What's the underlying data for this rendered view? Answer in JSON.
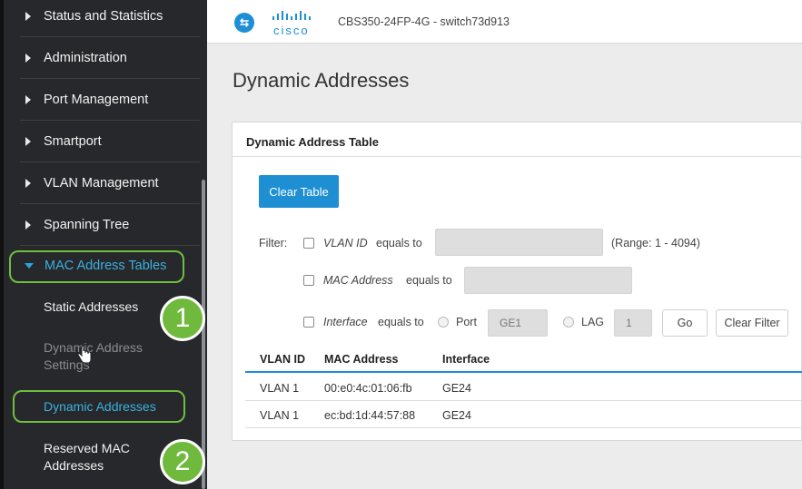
{
  "sidebar": {
    "items": [
      {
        "label": "Status and Statistics"
      },
      {
        "label": "Administration"
      },
      {
        "label": "Port Management"
      },
      {
        "label": "Smartport"
      },
      {
        "label": "VLAN Management"
      },
      {
        "label": "Spanning Tree"
      },
      {
        "label": "MAC Address Tables"
      }
    ],
    "sub_items": [
      {
        "label": "Static Addresses"
      },
      {
        "label": "Dynamic Address"
      },
      {
        "label": "Settings"
      },
      {
        "label": "Dynamic Addresses"
      },
      {
        "label": "Reserved MAC"
      },
      {
        "label": "Addresses"
      }
    ]
  },
  "badges": {
    "one": "1",
    "two": "2"
  },
  "header": {
    "logo_text": "cisco",
    "device": "CBS350-24FP-4G - switch73d913"
  },
  "page": {
    "title": "Dynamic Addresses"
  },
  "panel": {
    "title": "Dynamic Address Table",
    "clear_table": "Clear Table",
    "filter_label": "Filter:",
    "vlan_id_label": "VLAN ID",
    "mac_address_label": "MAC Address",
    "interface_label": "Interface",
    "equals_to": "equals to",
    "range_hint": "(Range: 1 - 4094)",
    "port_label": "Port",
    "port_value": "GE1",
    "lag_label": "LAG",
    "lag_value": "1",
    "go": "Go",
    "clear_filter": "Clear Filter"
  },
  "table": {
    "headers": [
      "VLAN ID",
      "MAC Address",
      "Interface"
    ],
    "rows": [
      [
        "VLAN 1",
        "00:e0:4c:01:06:fb",
        "GE24"
      ],
      [
        "VLAN 1",
        "ec:bd:1d:44:57:88",
        "GE24"
      ]
    ]
  },
  "colors": {
    "accent": "#1e8fd3",
    "highlight": "#6fbf3f",
    "sidebar_bg": "#26282b"
  }
}
